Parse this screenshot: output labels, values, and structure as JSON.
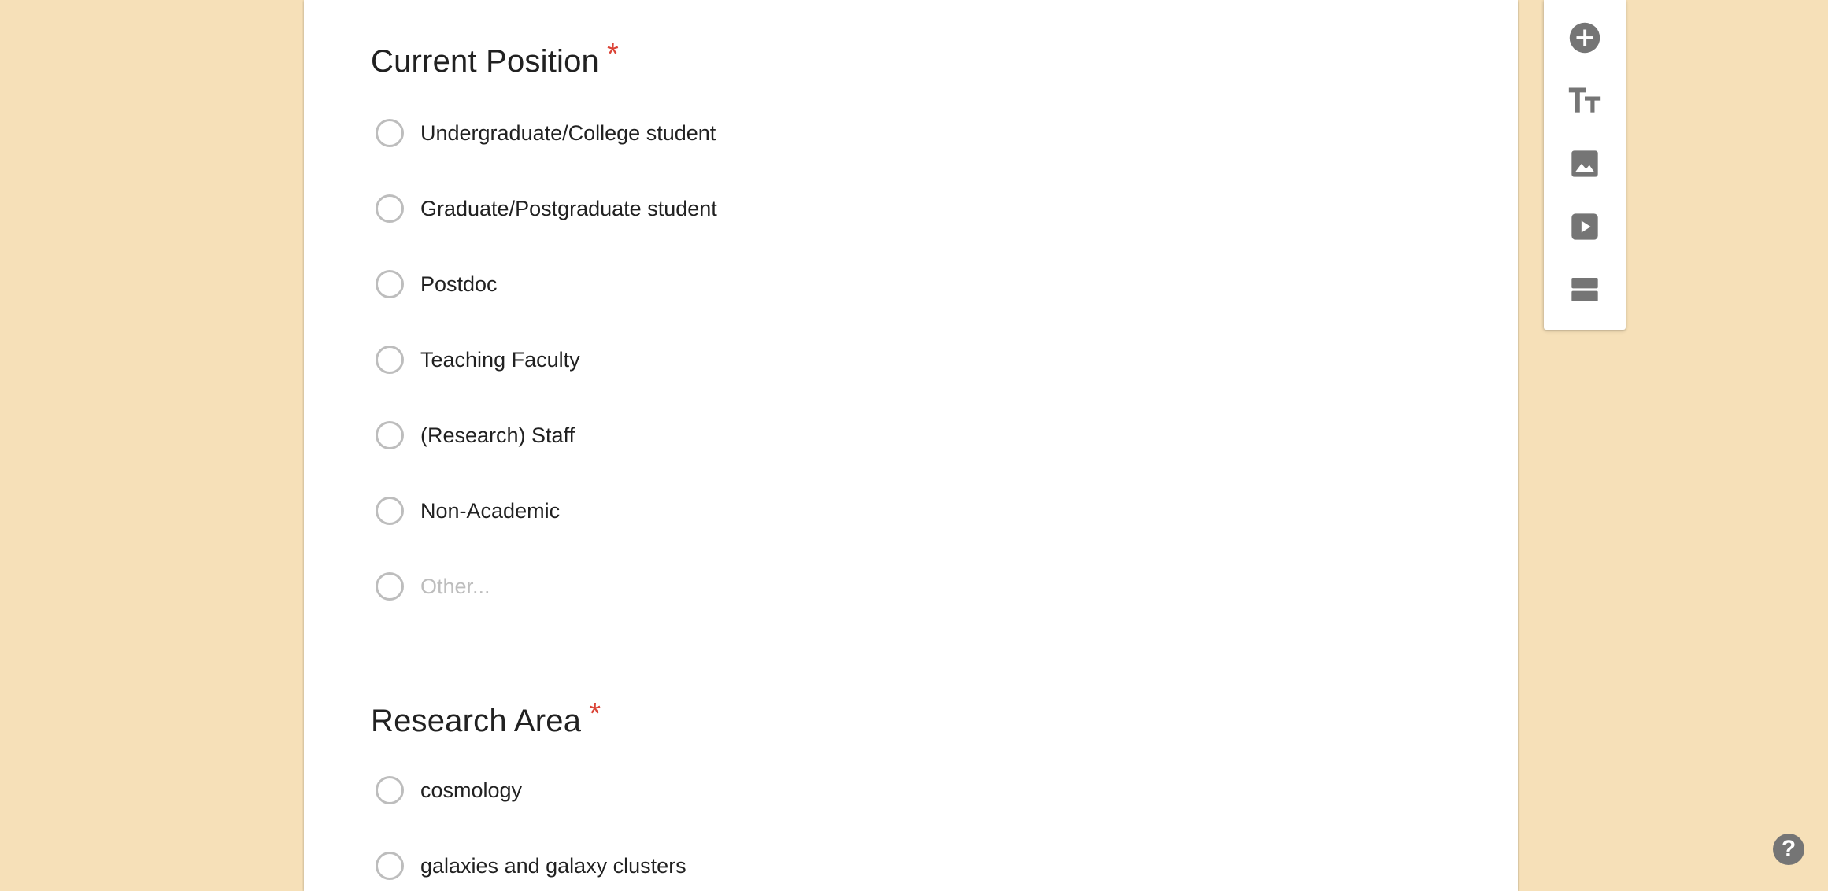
{
  "questions": [
    {
      "title": "Current Position",
      "required_mark": "*",
      "options": [
        {
          "label": "Undergraduate/College student"
        },
        {
          "label": "Graduate/Postgraduate student"
        },
        {
          "label": "Postdoc"
        },
        {
          "label": "Teaching Faculty"
        },
        {
          "label": "(Research) Staff"
        },
        {
          "label": "Non-Academic"
        },
        {
          "label": "Other..."
        }
      ]
    },
    {
      "title": "Research Area",
      "required_mark": "*",
      "options": [
        {
          "label": "cosmology"
        },
        {
          "label": "galaxies and galaxy clusters"
        }
      ]
    }
  ],
  "toolbar": {
    "items": [
      {
        "icon": "add-circle-icon"
      },
      {
        "icon": "title-text-icon"
      },
      {
        "icon": "image-icon"
      },
      {
        "icon": "video-icon"
      },
      {
        "icon": "section-icon"
      }
    ]
  },
  "help": {
    "label": "?"
  },
  "colors": {
    "background": "#f6e0b8",
    "card": "#ffffff",
    "required": "#db4437",
    "icon": "#757575",
    "radio_border": "#bdbdbd"
  }
}
